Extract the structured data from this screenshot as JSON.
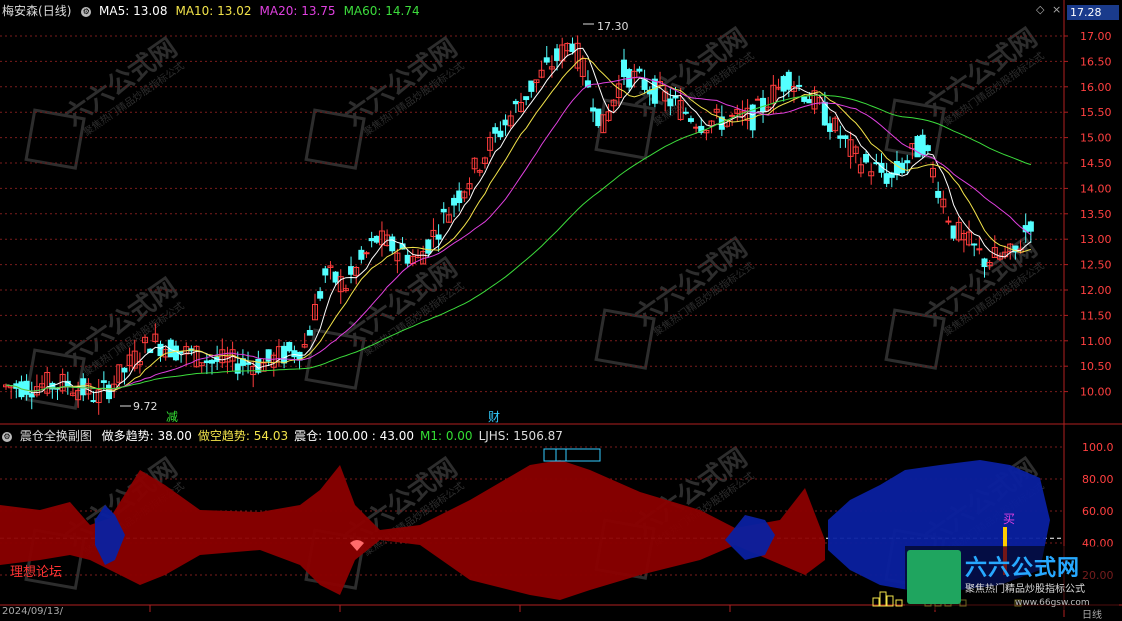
{
  "header": {
    "stock_name": "梅安森",
    "period": "(日线)",
    "ma": [
      {
        "label": "MA5:",
        "value": "13.08",
        "color": "#ffffff"
      },
      {
        "label": "MA10:",
        "value": "13.02",
        "color": "#f2e34a"
      },
      {
        "label": "MA20:",
        "value": "13.75",
        "color": "#e040e0"
      },
      {
        "label": "MA60:",
        "value": "14.74",
        "color": "#3cdc3c"
      }
    ],
    "current_price": "17.28"
  },
  "main_chart": {
    "y_ticks": [
      "17.00",
      "16.50",
      "16.00",
      "15.50",
      "15.00",
      "14.50",
      "14.00",
      "13.50",
      "13.00",
      "12.50",
      "12.00",
      "11.50",
      "11.00",
      "10.50",
      "10.00"
    ],
    "high_annotation": "17.30",
    "low_annotation": "9.72",
    "event_markers": [
      {
        "label": "减",
        "color": "#33dd33"
      },
      {
        "label": "财",
        "color": "#33ccff"
      }
    ]
  },
  "sub_chart": {
    "title": "震仓全换副图",
    "items": [
      {
        "label": "做多趋势:",
        "value": "38.00",
        "color": "#ffffff"
      },
      {
        "label": "做空趋势:",
        "value": "54.03",
        "color": "#f2e34a"
      },
      {
        "label": "震仓:",
        "value": "100.00 : 43.00",
        "color": "#ffffff"
      },
      {
        "label": "M1:",
        "value": "0.00",
        "color": "#33dd33"
      },
      {
        "label": "LJHS:",
        "value": "1506.87",
        "color": "#dddddd"
      }
    ],
    "y_ticks": [
      "100.0",
      "80.00",
      "60.00",
      "40.00",
      "20.00"
    ],
    "left_label": "理想论坛",
    "buy_label": "买"
  },
  "footer": {
    "date": "2024/09/13/",
    "right_label": "日线"
  },
  "watermark": {
    "brand": "六六公式网",
    "sub": "聚焦热门精品炒股指标公式",
    "url": "www.66gsw.com"
  },
  "colors": {
    "up": "#ff3c3c",
    "down": "#54ffff",
    "grid": "#7a1c1c",
    "axis": "#b02020",
    "bull_area": "#8b0000",
    "bear_area": "#0a20a0"
  }
}
